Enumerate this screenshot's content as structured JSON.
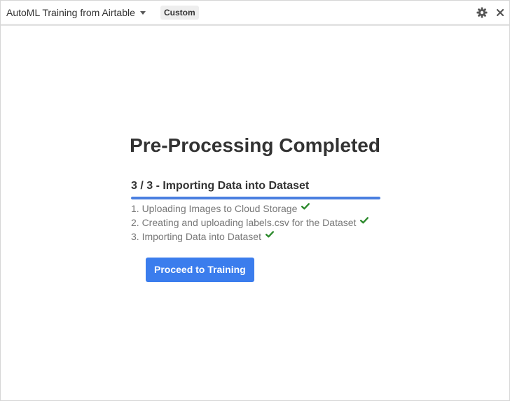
{
  "titlebar": {
    "app_title": "AutoML Training from Airtable",
    "dropdown_icon": "caret-down-icon",
    "badge": "Custom",
    "settings_icon": "gear-icon",
    "close_icon": "close-icon"
  },
  "main": {
    "heading": "Pre-Processing Completed",
    "step_title": "3 / 3 - Importing Data into Dataset",
    "progress": {
      "current": 3,
      "total": 3,
      "fraction": 1.0
    },
    "steps": [
      {
        "label": "1. Uploading Images to Cloud Storage",
        "status": "done"
      },
      {
        "label": "2. Creating and uploading labels.csv for the Dataset",
        "status": "done"
      },
      {
        "label": "3. Importing Data into Dataset",
        "status": "done"
      }
    ],
    "proceed_button": "Proceed to Training"
  },
  "colors": {
    "accent": "#3b7ded",
    "progress": "#4a7fe0",
    "check": "#2d8a2d"
  }
}
